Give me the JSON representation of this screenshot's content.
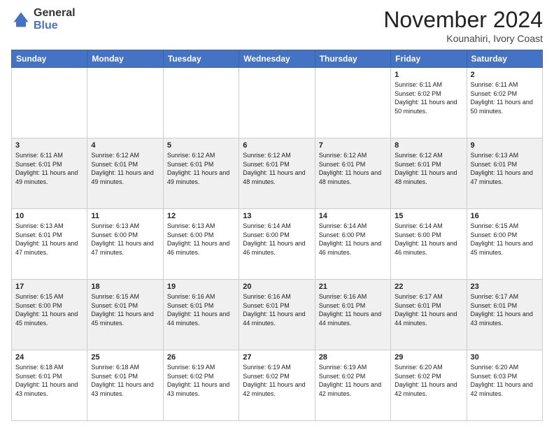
{
  "header": {
    "logo_general": "General",
    "logo_blue": "Blue",
    "month": "November 2024",
    "location": "Kounahiri, Ivory Coast"
  },
  "days_of_week": [
    "Sunday",
    "Monday",
    "Tuesday",
    "Wednesday",
    "Thursday",
    "Friday",
    "Saturday"
  ],
  "weeks": [
    [
      {
        "day": "",
        "info": ""
      },
      {
        "day": "",
        "info": ""
      },
      {
        "day": "",
        "info": ""
      },
      {
        "day": "",
        "info": ""
      },
      {
        "day": "",
        "info": ""
      },
      {
        "day": "1",
        "info": "Sunrise: 6:11 AM\nSunset: 6:02 PM\nDaylight: 11 hours\nand 50 minutes."
      },
      {
        "day": "2",
        "info": "Sunrise: 6:11 AM\nSunset: 6:02 PM\nDaylight: 11 hours\nand 50 minutes."
      }
    ],
    [
      {
        "day": "3",
        "info": "Sunrise: 6:11 AM\nSunset: 6:01 PM\nDaylight: 11 hours\nand 49 minutes."
      },
      {
        "day": "4",
        "info": "Sunrise: 6:12 AM\nSunset: 6:01 PM\nDaylight: 11 hours\nand 49 minutes."
      },
      {
        "day": "5",
        "info": "Sunrise: 6:12 AM\nSunset: 6:01 PM\nDaylight: 11 hours\nand 49 minutes."
      },
      {
        "day": "6",
        "info": "Sunrise: 6:12 AM\nSunset: 6:01 PM\nDaylight: 11 hours\nand 48 minutes."
      },
      {
        "day": "7",
        "info": "Sunrise: 6:12 AM\nSunset: 6:01 PM\nDaylight: 11 hours\nand 48 minutes."
      },
      {
        "day": "8",
        "info": "Sunrise: 6:12 AM\nSunset: 6:01 PM\nDaylight: 11 hours\nand 48 minutes."
      },
      {
        "day": "9",
        "info": "Sunrise: 6:13 AM\nSunset: 6:01 PM\nDaylight: 11 hours\nand 47 minutes."
      }
    ],
    [
      {
        "day": "10",
        "info": "Sunrise: 6:13 AM\nSunset: 6:01 PM\nDaylight: 11 hours\nand 47 minutes."
      },
      {
        "day": "11",
        "info": "Sunrise: 6:13 AM\nSunset: 6:00 PM\nDaylight: 11 hours\nand 47 minutes."
      },
      {
        "day": "12",
        "info": "Sunrise: 6:13 AM\nSunset: 6:00 PM\nDaylight: 11 hours\nand 46 minutes."
      },
      {
        "day": "13",
        "info": "Sunrise: 6:14 AM\nSunset: 6:00 PM\nDaylight: 11 hours\nand 46 minutes."
      },
      {
        "day": "14",
        "info": "Sunrise: 6:14 AM\nSunset: 6:00 PM\nDaylight: 11 hours\nand 46 minutes."
      },
      {
        "day": "15",
        "info": "Sunrise: 6:14 AM\nSunset: 6:00 PM\nDaylight: 11 hours\nand 46 minutes."
      },
      {
        "day": "16",
        "info": "Sunrise: 6:15 AM\nSunset: 6:00 PM\nDaylight: 11 hours\nand 45 minutes."
      }
    ],
    [
      {
        "day": "17",
        "info": "Sunrise: 6:15 AM\nSunset: 6:00 PM\nDaylight: 11 hours\nand 45 minutes."
      },
      {
        "day": "18",
        "info": "Sunrise: 6:15 AM\nSunset: 6:01 PM\nDaylight: 11 hours\nand 45 minutes."
      },
      {
        "day": "19",
        "info": "Sunrise: 6:16 AM\nSunset: 6:01 PM\nDaylight: 11 hours\nand 44 minutes."
      },
      {
        "day": "20",
        "info": "Sunrise: 6:16 AM\nSunset: 6:01 PM\nDaylight: 11 hours\nand 44 minutes."
      },
      {
        "day": "21",
        "info": "Sunrise: 6:16 AM\nSunset: 6:01 PM\nDaylight: 11 hours\nand 44 minutes."
      },
      {
        "day": "22",
        "info": "Sunrise: 6:17 AM\nSunset: 6:01 PM\nDaylight: 11 hours\nand 44 minutes."
      },
      {
        "day": "23",
        "info": "Sunrise: 6:17 AM\nSunset: 6:01 PM\nDaylight: 11 hours\nand 43 minutes."
      }
    ],
    [
      {
        "day": "24",
        "info": "Sunrise: 6:18 AM\nSunset: 6:01 PM\nDaylight: 11 hours\nand 43 minutes."
      },
      {
        "day": "25",
        "info": "Sunrise: 6:18 AM\nSunset: 6:01 PM\nDaylight: 11 hours\nand 43 minutes."
      },
      {
        "day": "26",
        "info": "Sunrise: 6:19 AM\nSunset: 6:02 PM\nDaylight: 11 hours\nand 43 minutes."
      },
      {
        "day": "27",
        "info": "Sunrise: 6:19 AM\nSunset: 6:02 PM\nDaylight: 11 hours\nand 42 minutes."
      },
      {
        "day": "28",
        "info": "Sunrise: 6:19 AM\nSunset: 6:02 PM\nDaylight: 11 hours\nand 42 minutes."
      },
      {
        "day": "29",
        "info": "Sunrise: 6:20 AM\nSunset: 6:02 PM\nDaylight: 11 hours\nand 42 minutes."
      },
      {
        "day": "30",
        "info": "Sunrise: 6:20 AM\nSunset: 6:03 PM\nDaylight: 11 hours\nand 42 minutes."
      }
    ]
  ]
}
